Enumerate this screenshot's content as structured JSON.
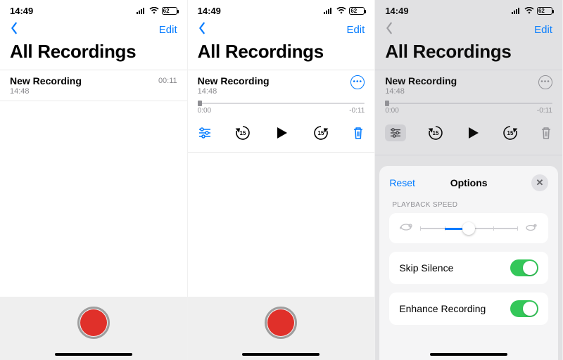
{
  "status": {
    "time": "14:49",
    "battery": "62"
  },
  "nav": {
    "edit": "Edit"
  },
  "title": "All Recordings",
  "recording": {
    "name": "New Recording",
    "time": "14:48",
    "duration": "00:11",
    "elapsed": "0:00",
    "remaining": "-0:11",
    "skip_seconds": "15"
  },
  "sheet": {
    "reset": "Reset",
    "title": "Options",
    "speed_label": "PLAYBACK SPEED",
    "skip_silence": "Skip Silence",
    "enhance": "Enhance Recording",
    "skip_silence_on": true,
    "enhance_on": true
  },
  "colors": {
    "accent": "#007aff",
    "record": "#e0302a",
    "toggle_on": "#34c759"
  }
}
